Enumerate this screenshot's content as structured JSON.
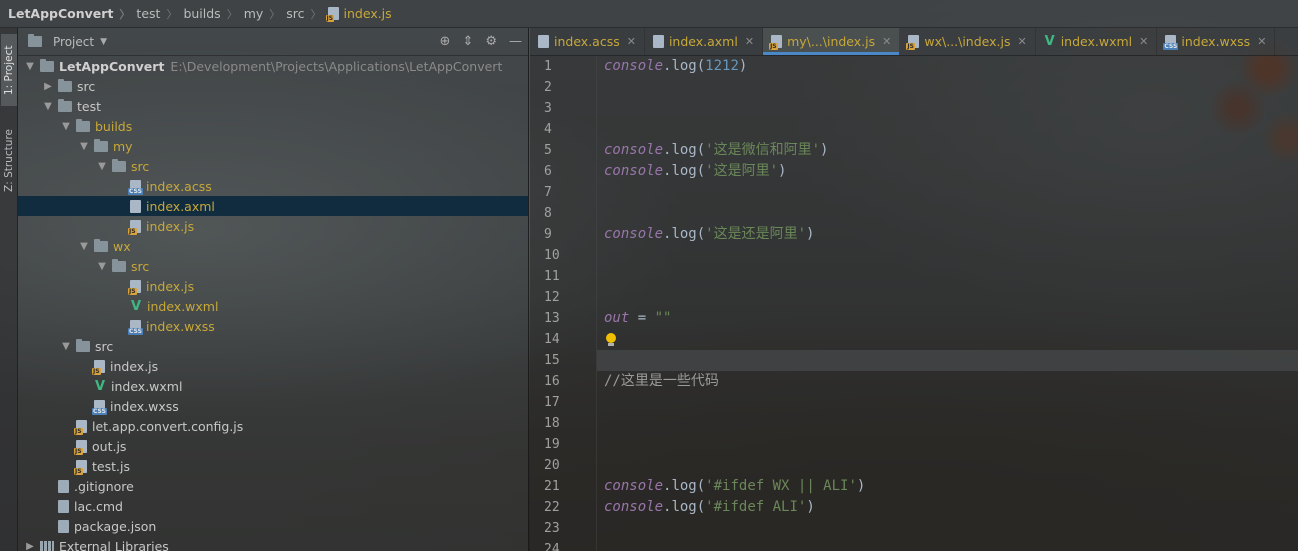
{
  "breadcrumbs": [
    "LetAppConvert",
    "test",
    "builds",
    "my",
    "src",
    "index.js"
  ],
  "toolstrip": {
    "project_tab": "1: Project",
    "structure_tab": "Z: Structure"
  },
  "project_panel": {
    "title": "Project",
    "root": {
      "name": "LetAppConvert",
      "path": "E:\\Development\\Projects\\Applications\\LetAppConvert"
    },
    "tree": [
      {
        "label": "src",
        "kind": "folder",
        "depth": 1,
        "arrow": "right",
        "color": "normal"
      },
      {
        "label": "test",
        "kind": "folder",
        "depth": 1,
        "arrow": "down",
        "color": "normal"
      },
      {
        "label": "builds",
        "kind": "folder",
        "depth": 2,
        "arrow": "down",
        "color": "yellow"
      },
      {
        "label": "my",
        "kind": "folder",
        "depth": 3,
        "arrow": "down",
        "color": "yellow"
      },
      {
        "label": "src",
        "kind": "folder",
        "depth": 4,
        "arrow": "down",
        "color": "yellow"
      },
      {
        "label": "index.acss",
        "kind": "css",
        "depth": 5,
        "arrow": "",
        "color": "yellow"
      },
      {
        "label": "index.axml",
        "kind": "file",
        "depth": 5,
        "arrow": "",
        "color": "yellow",
        "selected": true
      },
      {
        "label": "index.js",
        "kind": "js",
        "depth": 5,
        "arrow": "",
        "color": "yellow"
      },
      {
        "label": "wx",
        "kind": "folder",
        "depth": 3,
        "arrow": "down",
        "color": "yellow"
      },
      {
        "label": "src",
        "kind": "folder",
        "depth": 4,
        "arrow": "down",
        "color": "yellow"
      },
      {
        "label": "index.js",
        "kind": "js",
        "depth": 5,
        "arrow": "",
        "color": "yellow"
      },
      {
        "label": "index.wxml",
        "kind": "vue",
        "depth": 5,
        "arrow": "",
        "color": "yellow"
      },
      {
        "label": "index.wxss",
        "kind": "css",
        "depth": 5,
        "arrow": "",
        "color": "yellow"
      },
      {
        "label": "src",
        "kind": "folder",
        "depth": 2,
        "arrow": "down",
        "color": "normal"
      },
      {
        "label": "index.js",
        "kind": "js",
        "depth": 3,
        "arrow": "",
        "color": "normal"
      },
      {
        "label": "index.wxml",
        "kind": "vue",
        "depth": 3,
        "arrow": "",
        "color": "normal"
      },
      {
        "label": "index.wxss",
        "kind": "css",
        "depth": 3,
        "arrow": "",
        "color": "normal"
      },
      {
        "label": "let.app.convert.config.js",
        "kind": "js",
        "depth": 2,
        "arrow": "",
        "color": "normal"
      },
      {
        "label": "out.js",
        "kind": "js",
        "depth": 2,
        "arrow": "",
        "color": "normal"
      },
      {
        "label": "test.js",
        "kind": "js",
        "depth": 2,
        "arrow": "",
        "color": "normal"
      },
      {
        "label": ".gitignore",
        "kind": "txt",
        "depth": 1,
        "arrow": "",
        "color": "normal"
      },
      {
        "label": "lac.cmd",
        "kind": "txt",
        "depth": 1,
        "arrow": "",
        "color": "normal"
      },
      {
        "label": "package.json",
        "kind": "txt",
        "depth": 1,
        "arrow": "",
        "color": "normal"
      },
      {
        "label": "External Libraries",
        "kind": "lib",
        "depth": 0,
        "arrow": "right",
        "color": "normal"
      }
    ]
  },
  "editor_tabs": [
    {
      "label": "index.acss",
      "kind": "file",
      "active": false
    },
    {
      "label": "index.axml",
      "kind": "file",
      "active": false
    },
    {
      "label": "my\\...\\index.js",
      "kind": "js",
      "active": true
    },
    {
      "label": "wx\\...\\index.js",
      "kind": "js",
      "active": false
    },
    {
      "label": "index.wxml",
      "kind": "vue",
      "active": false
    },
    {
      "label": "index.wxss",
      "kind": "css",
      "active": false
    }
  ],
  "code": {
    "line_numbers": [
      "1",
      "2",
      "3",
      "4",
      "5",
      "6",
      "7",
      "8",
      "9",
      "10",
      "11",
      "12",
      "13",
      "14",
      "15",
      "16",
      "17",
      "18",
      "19",
      "20",
      "21",
      "22",
      "23",
      "24"
    ],
    "current_line": 15,
    "lines": [
      {
        "n": 1,
        "obj": "console",
        "mid": ".log(",
        "num": "1212",
        "str": "",
        "end": ")"
      },
      {
        "n": 5,
        "obj": "console",
        "mid": ".log(",
        "num": "",
        "str": "'这是微信和阿里'",
        "end": ")"
      },
      {
        "n": 6,
        "obj": "console",
        "mid": ".log(",
        "num": "",
        "str": "'这是阿里'",
        "end": ")"
      },
      {
        "n": 9,
        "obj": "console",
        "mid": ".log(",
        "num": "",
        "str": "'这是还是阿里'",
        "end": ")"
      },
      {
        "n": 13,
        "obj": "out",
        "mid": " = ",
        "num": "",
        "str": "\"\"",
        "end": ""
      },
      {
        "n": 16,
        "comment": "//这里是一些代码"
      },
      {
        "n": 21,
        "obj": "console",
        "mid": ".log(",
        "num": "",
        "str": "'#ifdef WX || ALI'",
        "end": ")"
      },
      {
        "n": 22,
        "obj": "console",
        "mid": ".log(",
        "num": "",
        "str": "'#ifdef ALI'",
        "end": ")"
      }
    ]
  }
}
